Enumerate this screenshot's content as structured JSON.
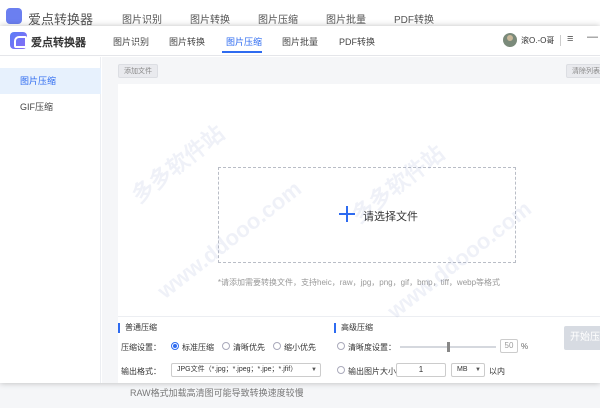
{
  "background_window": {
    "title": "爱点转换器",
    "nav": [
      "图片识别",
      "图片转换",
      "图片压缩",
      "图片批量",
      "PDF转换"
    ],
    "status_text": "RAW格式加载高清图可能导致转换速度较慢"
  },
  "header": {
    "title": "爱点转换器",
    "nav": [
      {
        "label": "图片识别"
      },
      {
        "label": "图片转换"
      },
      {
        "label": "图片压缩"
      },
      {
        "label": "图片批量"
      },
      {
        "label": "PDF转换"
      }
    ],
    "active_nav": "图片压缩",
    "username": "滚O.-O哥",
    "menu_icon": "≡",
    "minimize_icon": "—"
  },
  "sidebar": {
    "items": [
      {
        "label": "图片压缩",
        "active": true
      },
      {
        "label": "GIF压缩",
        "active": false
      }
    ]
  },
  "toolbar": {
    "add_file": "添加文件",
    "clear_list": "清除列表"
  },
  "dropzone": {
    "label": "请选择文件",
    "formats_hint": "*请添加需要转换文件，支持heic，raw，jpg，png，gif，bmp，tiff，webp等格式"
  },
  "settings": {
    "normal": {
      "title": "普通压缩",
      "compress_setting_label": "压缩设置：",
      "options": [
        {
          "label": "标准压缩",
          "selected": true
        },
        {
          "label": "清晰优先",
          "selected": false
        },
        {
          "label": "缩小优先",
          "selected": false
        }
      ],
      "output_format_label": "输出格式：",
      "output_format_value": "JPG文件（*.jpg；*.jpeg；*.jpe；*.jfif）"
    },
    "advanced": {
      "title": "高级压缩",
      "clarity_label": "清晰度设置：",
      "clarity_value": "50",
      "clarity_unit": "%",
      "clarity_level": 0.5,
      "size_label": "输出图片大小",
      "size_value": "1",
      "size_unit": "MB",
      "size_suffix": "以内"
    },
    "start_button": "开始压缩"
  },
  "watermark": {
    "text_cn": "多多软件站",
    "text_en": "www.ddooo.com"
  },
  "colors": {
    "accent": "#2e6bf0",
    "sidebar_active_bg": "#e7f1fd",
    "start_disabled": "#d7dbe2"
  }
}
